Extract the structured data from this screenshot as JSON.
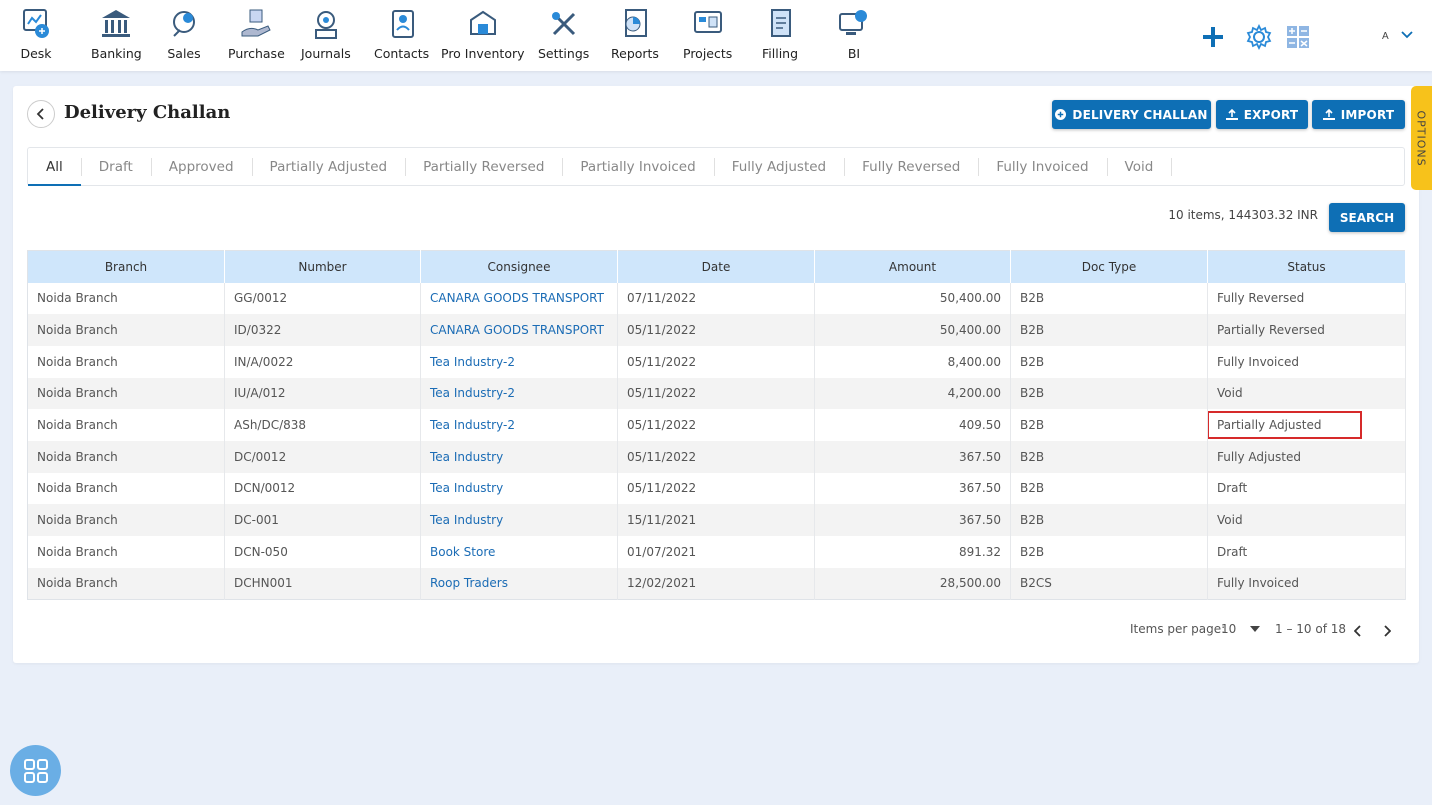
{
  "nav": {
    "items": [
      {
        "label": "Desk",
        "icon": "desk-icon"
      },
      {
        "label": "Banking",
        "icon": "bank-icon"
      },
      {
        "label": "Sales",
        "icon": "sales-icon"
      },
      {
        "label": "Purchase",
        "icon": "purchase-icon"
      },
      {
        "label": "Journals",
        "icon": "journals-icon"
      },
      {
        "label": "Contacts",
        "icon": "contacts-icon"
      },
      {
        "label": "Pro Inventory",
        "icon": "inventory-icon"
      },
      {
        "label": "Settings",
        "icon": "settings-tools-icon"
      },
      {
        "label": "Reports",
        "icon": "reports-icon"
      },
      {
        "label": "Projects",
        "icon": "projects-icon"
      },
      {
        "label": "Filling",
        "icon": "filling-icon"
      },
      {
        "label": "BI",
        "icon": "bi-icon"
      }
    ],
    "user_initial": "A",
    "accent": "#0e6fb5"
  },
  "page": {
    "title": "Delivery Challan",
    "buttons": {
      "delivery_challan": "DELIVERY CHALLAN",
      "export": "EXPORT",
      "import": "IMPORT"
    },
    "tabs": [
      "All",
      "Draft",
      "Approved",
      "Partially Adjusted",
      "Partially Reversed",
      "Partially Invoiced",
      "Fully Adjusted",
      "Fully Reversed",
      "Fully Invoiced",
      "Void"
    ],
    "active_tab": "All",
    "summary": "10 items, 144303.32 INR",
    "search_label": "SEARCH",
    "options_label": "OPTIONS"
  },
  "table": {
    "headers": [
      "Branch",
      "Number",
      "Consignee",
      "Date",
      "Amount",
      "Doc Type",
      "Status"
    ],
    "rows": [
      [
        "Noida Branch",
        "GG/0012",
        "CANARA GOODS TRANSPORT",
        "07/11/2022",
        "50,400.00",
        "B2B",
        "Fully Reversed"
      ],
      [
        "Noida Branch",
        "ID/0322",
        "CANARA GOODS TRANSPORT",
        "05/11/2022",
        "50,400.00",
        "B2B",
        "Partially Reversed"
      ],
      [
        "Noida Branch",
        "IN/A/0022",
        "Tea Industry-2",
        "05/11/2022",
        "8,400.00",
        "B2B",
        "Fully Invoiced"
      ],
      [
        "Noida Branch",
        "IU/A/012",
        "Tea Industry-2",
        "05/11/2022",
        "4,200.00",
        "B2B",
        "Void"
      ],
      [
        "Noida Branch",
        "ASh/DC/838",
        "Tea Industry-2",
        "05/11/2022",
        "409.50",
        "B2B",
        "Partially Adjusted"
      ],
      [
        "Noida Branch",
        "DC/0012",
        "Tea Industry",
        "05/11/2022",
        "367.50",
        "B2B",
        "Fully Adjusted"
      ],
      [
        "Noida Branch",
        "DCN/0012",
        "Tea Industry",
        "05/11/2022",
        "367.50",
        "B2B",
        "Draft"
      ],
      [
        "Noida Branch",
        "DC-001",
        "Tea Industry",
        "15/11/2021",
        "367.50",
        "B2B",
        "Void"
      ],
      [
        "Noida Branch",
        "DCN-050",
        "Book Store",
        "01/07/2021",
        "891.32",
        "B2B",
        "Draft"
      ],
      [
        "Noida Branch",
        "DCHN001",
        "Roop Traders",
        "12/02/2021",
        "28,500.00",
        "B2CS",
        "Fully Invoiced"
      ]
    ],
    "highlighted_row": 4
  },
  "pager": {
    "items_per_page_label": "Items per page:",
    "items_per_page": "10",
    "range": "1 – 10 of 18"
  }
}
